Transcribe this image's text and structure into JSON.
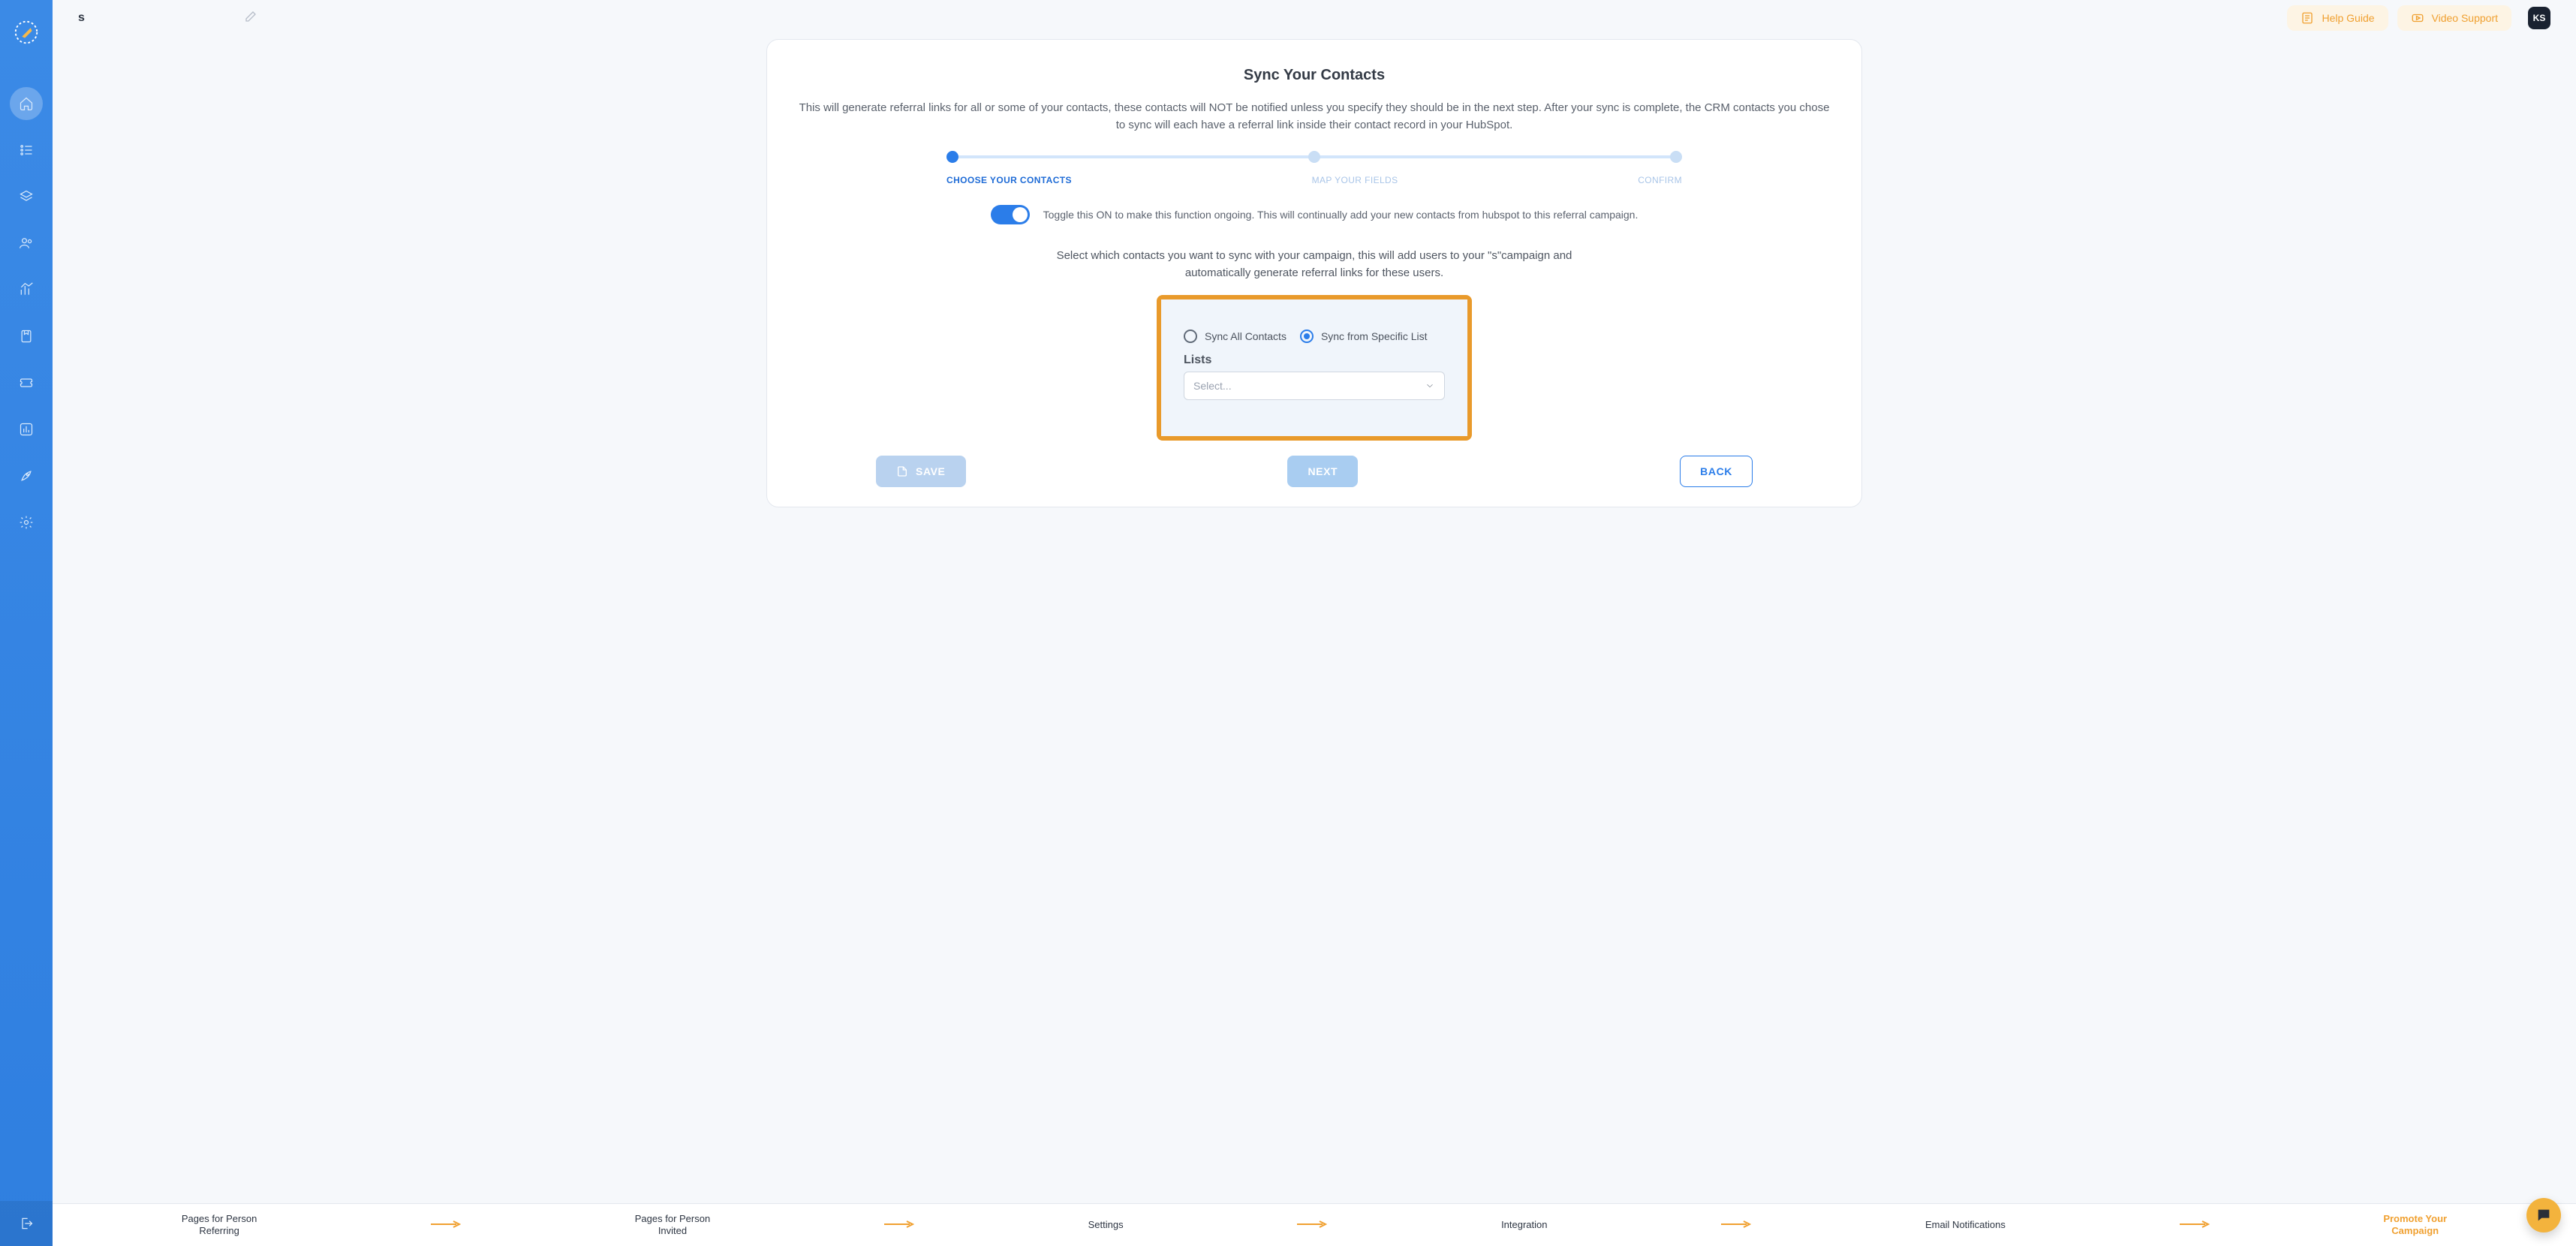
{
  "sidebar": {
    "icons": [
      "home",
      "list",
      "stack",
      "users",
      "analytics",
      "bookmark",
      "ticket",
      "graph",
      "rocket",
      "settings"
    ],
    "bottom": "exit"
  },
  "topbar": {
    "title": "s",
    "help_label": "Help Guide",
    "video_label": "Video Support",
    "avatar": "KS"
  },
  "page": {
    "heading": "Sync Your Contacts",
    "lead": "This will generate referral links for all or some of your contacts, these contacts will NOT be notified unless you specify they should be in the next step. After your sync is complete, the CRM contacts you chose to sync will each have a referral link inside their contact record in your HubSpot.",
    "steps": {
      "s1": "CHOOSE YOUR CONTACTS",
      "s2": "MAP YOUR FIELDS",
      "s3": "CONFIRM"
    },
    "toggle_text": "Toggle this ON to make this function ongoing. This will continually add your new contacts from hubspot to this referral campaign.",
    "subhead": "Select which contacts you want to sync with your campaign, this will add users to your \"s\"campaign and automatically generate referral links for these users.",
    "radio_all": "Sync All Contacts",
    "radio_list": "Sync from Specific List",
    "lists_label": "Lists",
    "select_placeholder": "Select...",
    "save": "SAVE",
    "next": "NEXT",
    "back": "BACK"
  },
  "crumbs": {
    "c1a": "Pages for Person",
    "c1b": "Referring",
    "c2a": "Pages for Person",
    "c2b": "Invited",
    "c3": "Settings",
    "c4": "Integration",
    "c5": "Email Notifications",
    "c6a": "Promote Your",
    "c6b": "Campaign"
  }
}
